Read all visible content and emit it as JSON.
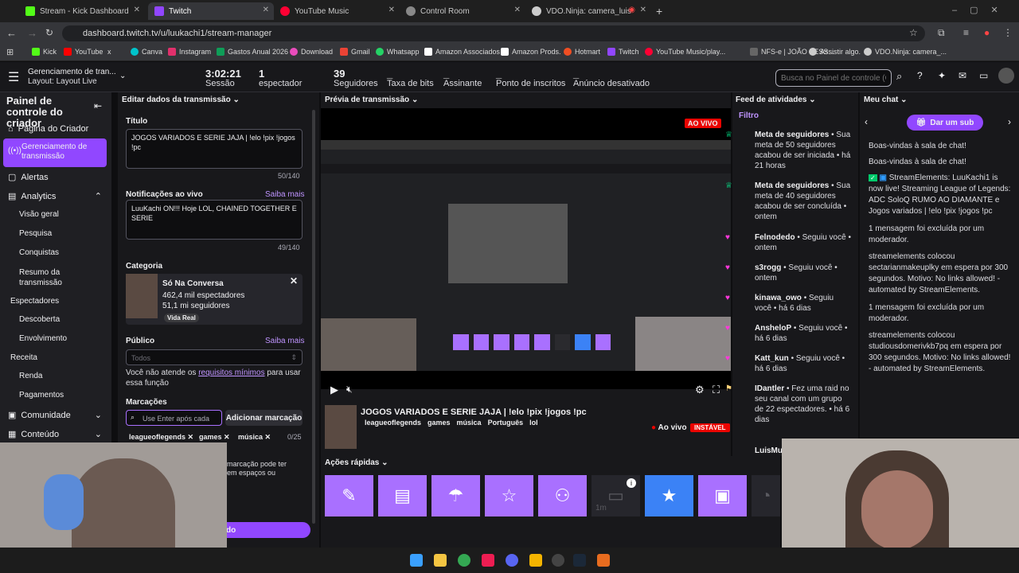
{
  "tabs": [
    {
      "label": "Stream - Kick Dashboard",
      "color": "#53fc18"
    },
    {
      "label": "Twitch",
      "color": "#9146ff"
    },
    {
      "label": "YouTube Music",
      "color": "#ff0033"
    },
    {
      "label": "Control Room",
      "color": "#888888"
    },
    {
      "label": "VDO.Ninja: camera_luis",
      "color": "#cccccc"
    }
  ],
  "url": "dashboard.twitch.tv/u/luukachi1/stream-manager",
  "bookmarks": [
    "Kick",
    "YouTube",
    "x",
    "Canva",
    "Instagram",
    "Gastos Anual 2026",
    "Download",
    "Gmail",
    "Whatsapp",
    "Amazon Associados",
    "Amazon Prods.",
    "Hotmart",
    "Twitch",
    "YouTube Music/play...",
    "NFS-e | JOÃO PESS...",
    "Assistir algo.",
    "VDO.Ninja: camera_..."
  ],
  "topbar": {
    "title": "Gerenciamento de tran...",
    "layout": "Layout: Layout Live",
    "session_time": "3:02:21",
    "session_label": "Sessão",
    "viewers": "1",
    "viewers_label": "espectador",
    "followers": "39",
    "followers_label": "Seguidores",
    "bits": "_",
    "bits_label": "Taxa de bits",
    "subs": "_",
    "subs_label": "Assinante",
    "points": "_",
    "points_label": "Ponto de inscritos",
    "ads": "_",
    "ads_label": "Anúncio desativado",
    "search_placeholder": "Busca no Painel de controle (C"
  },
  "sidebar": {
    "title": "Painel de controle do criador",
    "items": [
      "Página do Criador",
      "Gerenciamento de transmissão",
      "Alertas",
      "Analytics",
      "Visão geral",
      "Pesquisa",
      "Conquistas",
      "Resumo da transmissão",
      "Espectadores",
      "Descoberta",
      "Envolvimento",
      "Receita",
      "Renda",
      "Pagamentos",
      "Comunidade",
      "Conteúdo"
    ]
  },
  "edit": {
    "header": "Editar dados da transmissão",
    "title_label": "Título",
    "title_value": "JOGOS VARIADOS E SERIE JAJA | !elo !pix !jogos !pc",
    "title_count": "50/140",
    "notif_label": "Notificações ao vivo",
    "learn_more": "Saiba mais",
    "notif_value": "LuuKachi ON!!! Hoje LOL, CHAINED TOGETHER E SERIE",
    "notif_count": "49/140",
    "cat_label": "Categoria",
    "cat_name": "Só Na Conversa",
    "cat_viewers": "462,4 mil espectadores",
    "cat_followers": "51,1 mi seguidores",
    "cat_tag": "Vida Real",
    "aud_label": "Público",
    "aud_value": "Todos",
    "aud_note": "Você não atende os",
    "aud_link": "requisitos mínimos",
    "aud_note2": "para usar essa função",
    "tags_label": "Marcações",
    "tags_placeholder": "Use Enter após cada",
    "tags_button": "Adicionar marcação",
    "tags": [
      "leagueoflegends",
      "games",
      "música"
    ],
    "tags_count": "0/25",
    "tag_hint": "marcação pode ter",
    "tag_hint2": "em espaços ou",
    "save": "do"
  },
  "preview": {
    "header": "Prévia de transmissão",
    "live": "AO VIVO",
    "stream_title": "JOGOS VARIADOS E SERIE JAJA | !elo !pix !jogos !pc",
    "tags": [
      "leagueoflegends",
      "games",
      "música",
      "Português",
      "lol"
    ],
    "status": "Ao vivo",
    "unstable": "INSTÁVEL"
  },
  "quick_actions": {
    "header": "Ações rápidas",
    "count_label": "1m"
  },
  "feed": {
    "header": "Feed de atividades",
    "filter": "Filtro",
    "items": [
      {
        "title": "Meta de seguidores",
        "text": "• Sua meta de 50 seguidores acabou de ser iniciada • há 21 horas",
        "color": "#00f593"
      },
      {
        "title": "Meta de seguidores",
        "text": "• Sua meta de 40 seguidores acabou de ser concluída • ontem",
        "color": "#00f593"
      },
      {
        "title": "Felnodedo",
        "text": "• Seguiu você • ontem",
        "color": "#ff38db"
      },
      {
        "title": "s3rogg",
        "text": "• Seguiu você • ontem",
        "color": "#ff38db"
      },
      {
        "title": "kinawa_owo",
        "text": "• Seguiu você • há 6 dias",
        "color": "#ff38db"
      },
      {
        "title": "AnsheloP",
        "text": "• Seguiu você • há 6 dias",
        "color": "#ff38db"
      },
      {
        "title": "Katt_kun",
        "text": "• Seguiu você • há 6 dias",
        "color": "#ff38db"
      },
      {
        "title": "IDantler",
        "text": "• Fez uma raid no seu canal com um grupo de 22 espectadores. • há 6 dias",
        "color": "#ffd37a"
      },
      {
        "title": "LuisMu",
        "text": "",
        "color": "#ff38db"
      }
    ]
  },
  "chat": {
    "header": "Meu chat",
    "sub_button": "Dar um sub",
    "messages": [
      "Boas-vindas à sala de chat!",
      "Boas-vindas à sala de chat!",
      "StreamElements: LuuKachi1 is now live! Streaming League of Legends: ADC SoloQ RUMO AO DIAMANTE e Jogos variados | !elo !pix !jogos !pc",
      "1 mensagem foi excluída por um moderador.",
      "streamelements colocou sectarianmakeuplky em espera por 300 segundos. Motivo: No links allowed! - automated by StreamElements.",
      "1 mensagem foi excluída por um moderador.",
      "streamelements colocou studiousdomerivkb7pq em espera por 300 segundos. Motivo: No links allowed! - automated by StreamElements."
    ]
  },
  "colors": {
    "accent": "#9147ff",
    "qa": "#a970ff",
    "live": "#eb0400"
  }
}
